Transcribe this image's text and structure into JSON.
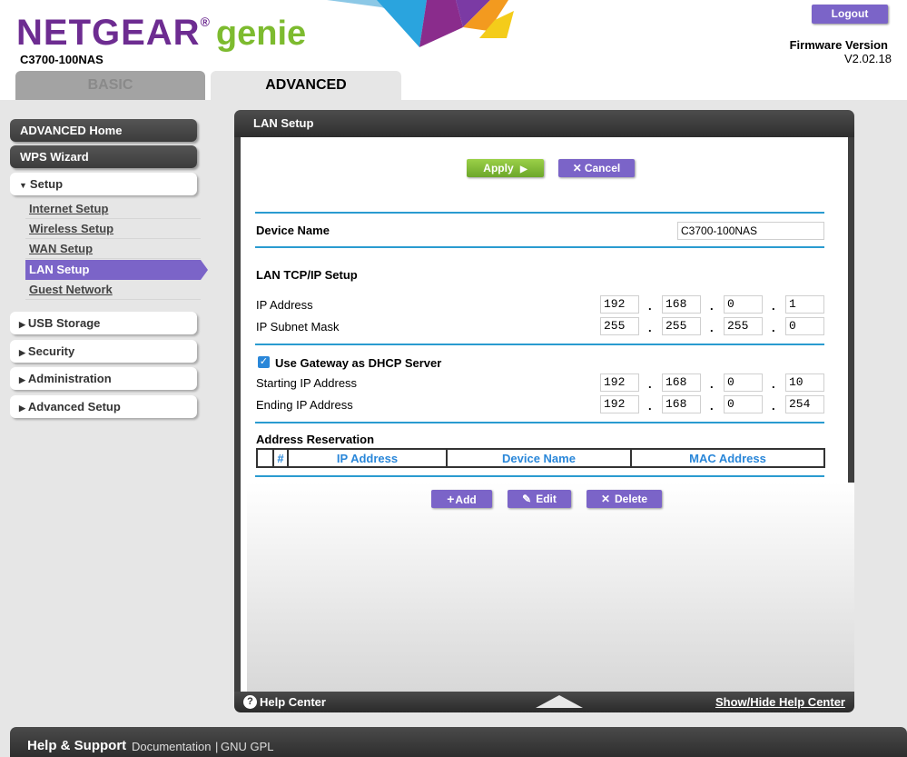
{
  "header": {
    "brand_netgear": "NETGEAR",
    "brand_reg": "®",
    "brand_genie": "genie",
    "model": "C3700-100NAS",
    "logout_label": "Logout",
    "firmware_label": "Firmware Version",
    "firmware_value": "V2.02.18",
    "tabs": {
      "basic": "BASIC",
      "advanced": "ADVANCED"
    }
  },
  "sidebar": {
    "advanced_home": "ADVANCED Home",
    "wps_wizard": "WPS Wizard",
    "setup": "Setup",
    "setup_items": [
      "Internet Setup",
      "Wireless Setup",
      "WAN Setup",
      "LAN Setup",
      "Guest Network"
    ],
    "usb_storage": "USB Storage",
    "security": "Security",
    "administration": "Administration",
    "advanced_setup": "Advanced Setup"
  },
  "panel": {
    "title": "LAN Setup",
    "apply_label": "Apply",
    "cancel_label": "Cancel",
    "device_name_label": "Device Name",
    "device_name_value": "C3700-100NAS",
    "lan_tcpip_heading": "LAN TCP/IP Setup",
    "ip_address_label": "IP Address",
    "ip_address": [
      "192",
      "168",
      "0",
      "1"
    ],
    "subnet_label": "IP Subnet Mask",
    "subnet": [
      "255",
      "255",
      "255",
      "0"
    ],
    "dhcp_label": "Use Gateway as DHCP Server",
    "dhcp_checked": true,
    "start_label": "Starting IP Address",
    "start_ip": [
      "192",
      "168",
      "0",
      "10"
    ],
    "end_label": "Ending IP Address",
    "end_ip": [
      "192",
      "168",
      "0",
      "254"
    ],
    "reservation_heading": "Address Reservation",
    "reservation_columns": [
      "#",
      "IP Address",
      "Device Name",
      "MAC Address"
    ],
    "add_label": "Add",
    "edit_label": "Edit",
    "delete_label": "Delete"
  },
  "helpbar": {
    "help_center": "Help Center",
    "toggle": "Show/Hide Help Center"
  },
  "footer": {
    "title": "Help & Support",
    "documentation": "Documentation",
    "separator": "|",
    "gnu_gpl": "GNU GPL"
  },
  "colors": {
    "brand_purple": "#6d2c91",
    "brand_green": "#7dbb2f",
    "accent_purple": "#7b64c8",
    "apply_green": "#7cba35",
    "divider_blue": "#2a9bd0",
    "column_blue": "#2a87d9"
  }
}
